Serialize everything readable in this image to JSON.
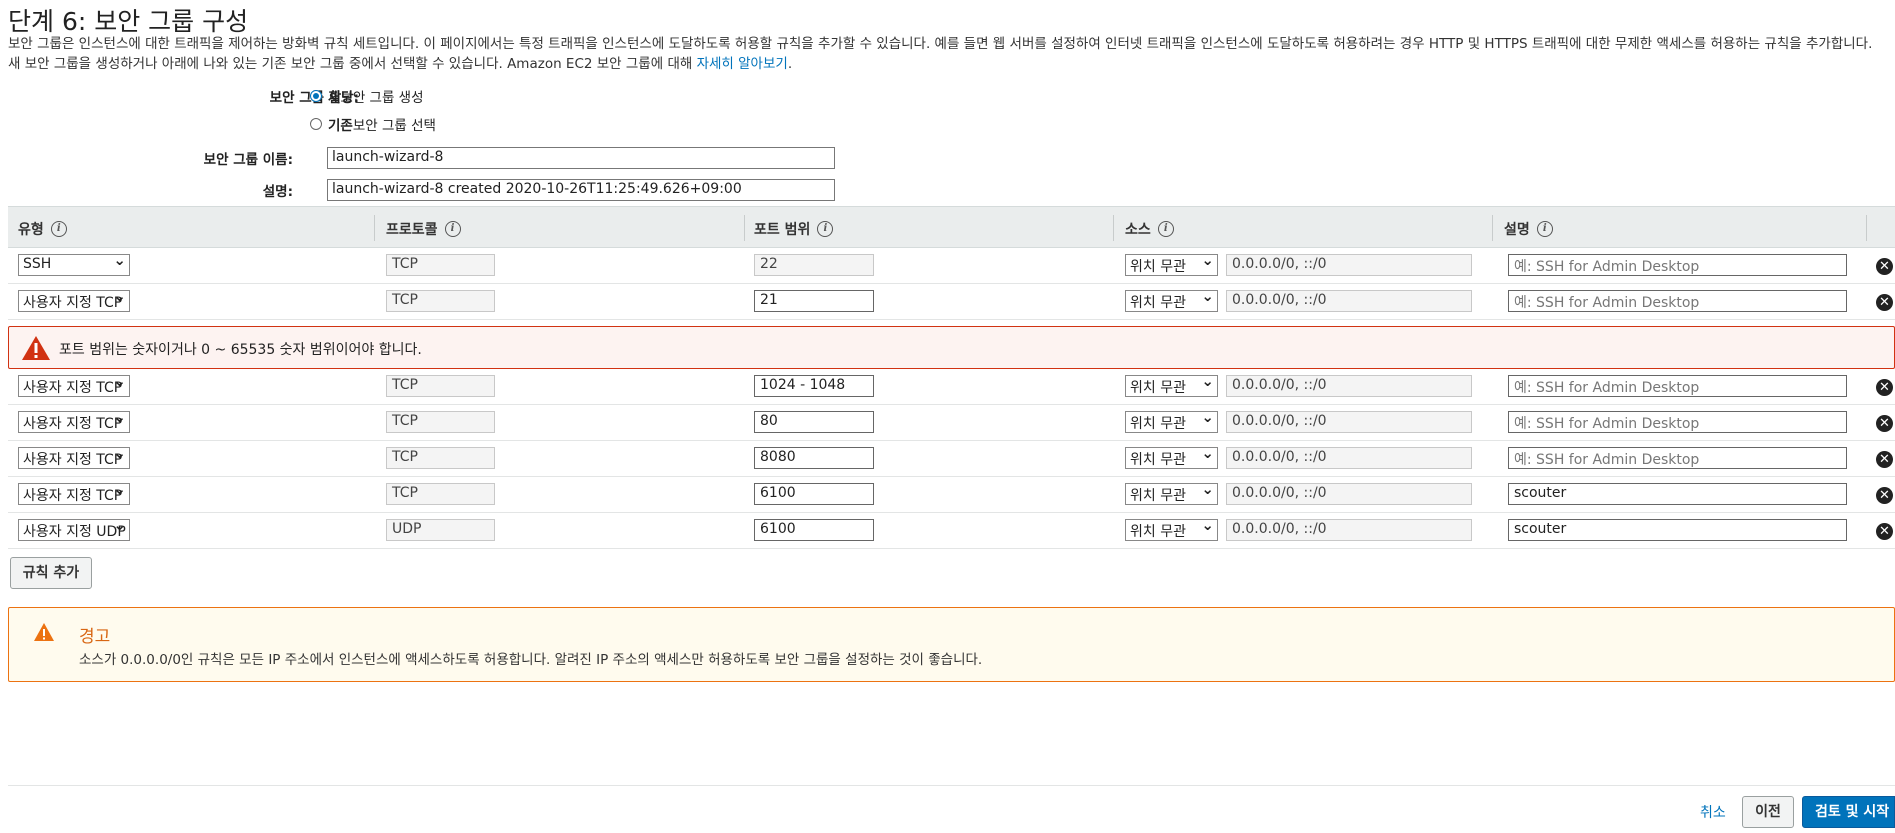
{
  "page": {
    "title": "단계 6: 보안 그룹 구성",
    "intro_text": "보안 그룹은 인스턴스에 대한 트래픽을 제어하는 방화벽 규칙 세트입니다. 이 페이지에서는 특정 트래픽을 인스턴스에 도달하도록 허용할 규칙을 추가할 수 있습니다. 예를 들면 웹 서버를 설정하여 인터넷 트래픽을 인스턴스에 도달하도록 허용하려는 경우 HTTP 및 HTTPS 트래픽에 대한 무제한 액세스를 허용하는 규칙을 추가합니다. 새 보안 그룹을 생성하거나 아래에 나와 있는 기존 보안 그룹 중에서 선택할 수 있습니다. Amazon EC2 보안 그룹에 대해 ",
    "learn_more": "자세히 알아보기",
    "learn_more_suffix": "."
  },
  "form": {
    "assign_label": "보안 그룹 할당:",
    "option_new_bold": "새",
    "option_new_rest": " 보안 그룹 생성",
    "option_existing_bold": "기존",
    "option_existing_rest": " 보안 그룹 선택",
    "selected_option": "new",
    "name_label": "보안 그룹 이름:",
    "name_value": "launch-wizard-8",
    "desc_label": "설명:",
    "desc_value": "launch-wizard-8 created 2020-10-26T11:25:49.626+09:00"
  },
  "table": {
    "headers": {
      "type": "유형",
      "protocol": "프로토콜",
      "port": "포트 범위",
      "source": "소스",
      "description": "설명"
    },
    "placeholder": "예: SSH for Admin Desktop",
    "source_cidr": "0.0.0.0/0, ::/0",
    "rows": [
      {
        "type": "SSH",
        "protocol": "TCP",
        "port": "22",
        "port_readonly": true,
        "source": "위치 무관",
        "cidr": "0.0.0.0/0, ::/0",
        "desc": ""
      },
      {
        "type": "사용자 지정 TCP",
        "protocol": "TCP",
        "port": "21",
        "port_readonly": false,
        "source": "위치 무관",
        "cidr": "0.0.0.0/0, ::/0",
        "desc": ""
      },
      {
        "type": "사용자 지정 TCP",
        "protocol": "TCP",
        "port": "1024 - 1048",
        "port_readonly": false,
        "source": "위치 무관",
        "cidr": "0.0.0.0/0, ::/0",
        "desc": ""
      },
      {
        "type": "사용자 지정 TCP",
        "protocol": "TCP",
        "port": "80",
        "port_readonly": false,
        "source": "위치 무관",
        "cidr": "0.0.0.0/0, ::/0",
        "desc": ""
      },
      {
        "type": "사용자 지정 TCP",
        "protocol": "TCP",
        "port": "8080",
        "port_readonly": false,
        "source": "위치 무관",
        "cidr": "0.0.0.0/0, ::/0",
        "desc": ""
      },
      {
        "type": "사용자 지정 TCP",
        "protocol": "TCP",
        "port": "6100",
        "port_readonly": false,
        "source": "위치 무관",
        "cidr": "0.0.0.0/0, ::/0",
        "desc": "scouter"
      },
      {
        "type": "사용자 지정 UDP",
        "protocol": "UDP",
        "port": "6100",
        "port_readonly": false,
        "source": "위치 무관",
        "cidr": "0.0.0.0/0, ::/0",
        "desc": "scouter"
      }
    ]
  },
  "error": {
    "icon": "warning-triangle-icon",
    "text": "포트 범위는 숫자이거나 0 ~ 65535 숫자 범위이어야 합니다."
  },
  "add_rule_label": "규칙 추가",
  "warning": {
    "icon": "warning-icon",
    "title": "경고",
    "text": "소스가 0.0.0.0/0인 규칙은 모든 IP 주소에서 인스턴스에 액세스하도록 허용합니다. 알려진 IP 주소의 액세스만 허용하도록 보안 그룹을 설정하는 것이 좋습니다."
  },
  "footer": {
    "cancel": "취소",
    "previous": "이전",
    "review_launch": "검토 및 시작"
  },
  "colors": {
    "accent": "#0073bb",
    "error_border": "#d13212",
    "warning_border": "#ec7211",
    "warning_title": "#d86613"
  }
}
